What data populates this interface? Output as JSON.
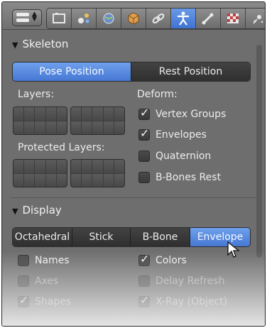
{
  "header": {
    "tabs": [
      {
        "icon": "render-icon",
        "active": false
      },
      {
        "icon": "scene-icon",
        "active": false
      },
      {
        "icon": "world-icon",
        "active": false
      },
      {
        "icon": "object-icon",
        "active": false
      },
      {
        "icon": "constraints-icon",
        "active": false
      },
      {
        "icon": "armature-data-icon",
        "active": true
      },
      {
        "icon": "bone-icon",
        "active": false
      },
      {
        "icon": "material-icon",
        "active": false
      },
      {
        "icon": "particles-icon",
        "active": false
      }
    ]
  },
  "skeleton": {
    "title": "Skeleton",
    "position_buttons": {
      "pose": "Pose Position",
      "rest": "Rest Position",
      "selected": "pose"
    },
    "layers_label": "Layers:",
    "protected_layers_label": "Protected Layers:",
    "deform_label": "Deform:",
    "deform_options": [
      {
        "label": "Vertex Groups",
        "checked": true
      },
      {
        "label": "Envelopes",
        "checked": true
      },
      {
        "label": "Quaternion",
        "checked": false
      },
      {
        "label": "B-Bones Rest",
        "checked": false
      }
    ]
  },
  "display": {
    "title": "Display",
    "modes": [
      "Octahedral",
      "Stick",
      "B-Bone",
      "Envelope"
    ],
    "selected_mode": "Envelope",
    "options_left": [
      {
        "label": "Names",
        "checked": false
      },
      {
        "label": "Axes",
        "checked": false
      },
      {
        "label": "Shapes",
        "checked": true
      }
    ],
    "options_right": [
      {
        "label": "Colors",
        "checked": true
      },
      {
        "label": "Delay Refresh",
        "checked": false
      },
      {
        "label": "X-Ray (Object)",
        "checked": true
      }
    ]
  },
  "colors": {
    "accent": "#4678d4",
    "panel_bg": "#6e6e6e",
    "button_dark": "#383838"
  }
}
